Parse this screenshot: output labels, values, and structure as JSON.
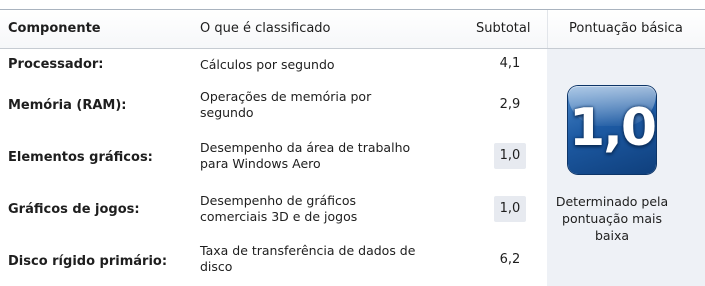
{
  "header": {
    "component": "Componente",
    "what": "O que é classificado",
    "subtotal": "Subtotal",
    "base": "Pontuação básica"
  },
  "rows": [
    {
      "component": "Processador:",
      "description": "Cálculos por segundo",
      "subtotal": "4,1"
    },
    {
      "component": "Memória (RAM):",
      "description": "Operações de memória por segundo",
      "subtotal": "2,9"
    },
    {
      "component": "Elementos gráficos:",
      "description": "Desempenho da área de trabalho para Windows Aero",
      "subtotal": "1,0"
    },
    {
      "component": "Gráficos de jogos:",
      "description": "Desempenho de gráficos comerciais 3D e de jogos",
      "subtotal": "1,0"
    },
    {
      "component": "Disco rígido primário:",
      "description": "Taxa de transferência de dados de disco",
      "subtotal": "6,2"
    }
  ],
  "base_score": {
    "value": "1,0",
    "note": "Determinado pela pontuação mais baixa"
  },
  "colors": {
    "tile_top": "#4a87c8",
    "tile_bottom": "#0f3f7c",
    "panel_bg": "#eef1f6",
    "lowest_cell_bg": "#e7eaf0"
  }
}
